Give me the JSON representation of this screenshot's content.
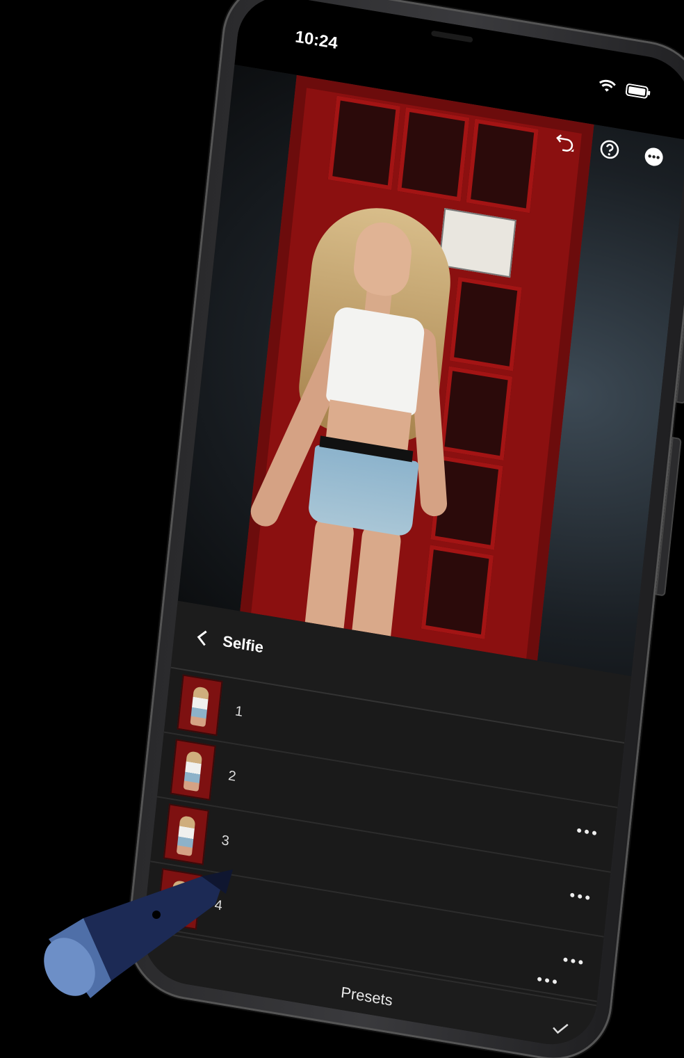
{
  "status_bar": {
    "time": "10:24"
  },
  "toolbar": {
    "undo_icon": "undo-icon",
    "help_icon": "help-icon",
    "more_icon": "more-icon"
  },
  "panel": {
    "title": "Selfie",
    "back_icon": "chevron-left-icon"
  },
  "presets": [
    {
      "label": "1",
      "has_more": false
    },
    {
      "label": "2",
      "has_more": true
    },
    {
      "label": "3",
      "has_more": true
    },
    {
      "label": "4",
      "has_more": true
    }
  ],
  "footer": {
    "label": "Presets",
    "confirm_icon": "check-icon"
  },
  "colors": {
    "booth_red": "#8b1010",
    "panel_bg": "#1c1c1c",
    "text": "#ffffff"
  }
}
